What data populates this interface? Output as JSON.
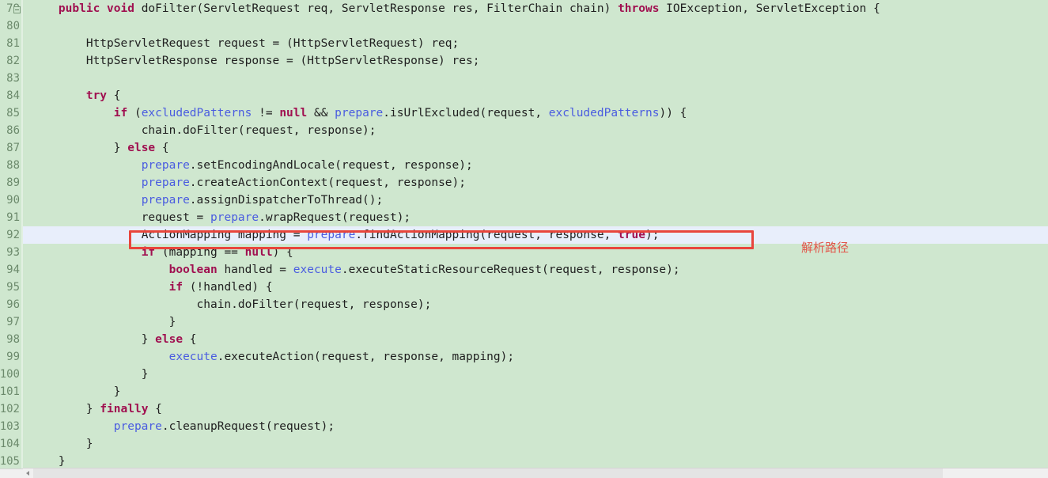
{
  "editor": {
    "background_color": "#cfe7cf",
    "current_line_color": "#e8eefb",
    "keyword_color": "#a01050",
    "field_color": "#4a5ce0",
    "text_color": "#202020",
    "gutter_number_color": "#6c8a6c",
    "highlight_box_color": "#e8453c",
    "annotation_color": "#e2574c",
    "first_line_number": 79,
    "current_line_number": 92
  },
  "gutter": {
    "line_numbers": [
      "79",
      "80",
      "81",
      "82",
      "83",
      "84",
      "85",
      "86",
      "87",
      "88",
      "89",
      "90",
      "91",
      "92",
      "93",
      "94",
      "95",
      "96",
      "97",
      "98",
      "99",
      "100",
      "101",
      "102",
      "103",
      "104",
      "105"
    ],
    "fold_marker_line": "79"
  },
  "annotation": {
    "text": "解析路径"
  },
  "code": {
    "lines": [
      {
        "n": "79",
        "indent": 4,
        "tokens": [
          {
            "t": "public",
            "c": "kw"
          },
          {
            "t": " ",
            "c": "plain"
          },
          {
            "t": "void",
            "c": "kw"
          },
          {
            "t": " doFilter(ServletRequest req, ServletResponse res, FilterChain chain) ",
            "c": "plain"
          },
          {
            "t": "throws",
            "c": "kw"
          },
          {
            "t": " IOException, ServletException {",
            "c": "plain"
          }
        ]
      },
      {
        "n": "80",
        "indent": 0,
        "tokens": [
          {
            "t": "",
            "c": "plain"
          }
        ]
      },
      {
        "n": "81",
        "indent": 8,
        "tokens": [
          {
            "t": "HttpServletRequest request = (HttpServletRequest) req;",
            "c": "plain"
          }
        ]
      },
      {
        "n": "82",
        "indent": 8,
        "tokens": [
          {
            "t": "HttpServletResponse response = (HttpServletResponse) res;",
            "c": "plain"
          }
        ]
      },
      {
        "n": "83",
        "indent": 0,
        "tokens": [
          {
            "t": "",
            "c": "plain"
          }
        ]
      },
      {
        "n": "84",
        "indent": 8,
        "tokens": [
          {
            "t": "try",
            "c": "kw"
          },
          {
            "t": " {",
            "c": "plain"
          }
        ]
      },
      {
        "n": "85",
        "indent": 12,
        "tokens": [
          {
            "t": "if",
            "c": "kw"
          },
          {
            "t": " (",
            "c": "plain"
          },
          {
            "t": "excludedPatterns",
            "c": "fld"
          },
          {
            "t": " != ",
            "c": "plain"
          },
          {
            "t": "null",
            "c": "kw"
          },
          {
            "t": " && ",
            "c": "plain"
          },
          {
            "t": "prepare",
            "c": "fld"
          },
          {
            "t": ".isUrlExcluded(request, ",
            "c": "plain"
          },
          {
            "t": "excludedPatterns",
            "c": "fld"
          },
          {
            "t": ")) {",
            "c": "plain"
          }
        ]
      },
      {
        "n": "86",
        "indent": 16,
        "tokens": [
          {
            "t": "chain.doFilter(request, response);",
            "c": "plain"
          }
        ]
      },
      {
        "n": "87",
        "indent": 12,
        "tokens": [
          {
            "t": "} ",
            "c": "plain"
          },
          {
            "t": "else",
            "c": "kw"
          },
          {
            "t": " {",
            "c": "plain"
          }
        ]
      },
      {
        "n": "88",
        "indent": 16,
        "tokens": [
          {
            "t": "prepare",
            "c": "fld"
          },
          {
            "t": ".setEncodingAndLocale(request, response);",
            "c": "plain"
          }
        ]
      },
      {
        "n": "89",
        "indent": 16,
        "tokens": [
          {
            "t": "prepare",
            "c": "fld"
          },
          {
            "t": ".createActionContext(request, response);",
            "c": "plain"
          }
        ]
      },
      {
        "n": "90",
        "indent": 16,
        "tokens": [
          {
            "t": "prepare",
            "c": "fld"
          },
          {
            "t": ".assignDispatcherToThread();",
            "c": "plain"
          }
        ]
      },
      {
        "n": "91",
        "indent": 16,
        "tokens": [
          {
            "t": "request = ",
            "c": "plain"
          },
          {
            "t": "prepare",
            "c": "fld"
          },
          {
            "t": ".wrapRequest(request);",
            "c": "plain"
          }
        ]
      },
      {
        "n": "92",
        "indent": 16,
        "tokens": [
          {
            "t": "ActionMapping mapping = ",
            "c": "plain"
          },
          {
            "t": "prepare",
            "c": "fld"
          },
          {
            "t": ".findActionMapping(request, response, ",
            "c": "plain"
          },
          {
            "t": "true",
            "c": "kw"
          },
          {
            "t": ");",
            "c": "plain"
          }
        ],
        "current": true
      },
      {
        "n": "93",
        "indent": 16,
        "tokens": [
          {
            "t": "if",
            "c": "kw"
          },
          {
            "t": " (mapping == ",
            "c": "plain"
          },
          {
            "t": "null",
            "c": "kw"
          },
          {
            "t": ") {",
            "c": "plain"
          }
        ]
      },
      {
        "n": "94",
        "indent": 20,
        "tokens": [
          {
            "t": "boolean",
            "c": "kw"
          },
          {
            "t": " handled = ",
            "c": "plain"
          },
          {
            "t": "execute",
            "c": "fld"
          },
          {
            "t": ".executeStaticResourceRequest(request, response);",
            "c": "plain"
          }
        ]
      },
      {
        "n": "95",
        "indent": 20,
        "tokens": [
          {
            "t": "if",
            "c": "kw"
          },
          {
            "t": " (!handled) {",
            "c": "plain"
          }
        ]
      },
      {
        "n": "96",
        "indent": 24,
        "tokens": [
          {
            "t": "chain.doFilter(request, response);",
            "c": "plain"
          }
        ]
      },
      {
        "n": "97",
        "indent": 20,
        "tokens": [
          {
            "t": "}",
            "c": "plain"
          }
        ]
      },
      {
        "n": "98",
        "indent": 16,
        "tokens": [
          {
            "t": "} ",
            "c": "plain"
          },
          {
            "t": "else",
            "c": "kw"
          },
          {
            "t": " {",
            "c": "plain"
          }
        ]
      },
      {
        "n": "99",
        "indent": 20,
        "tokens": [
          {
            "t": "execute",
            "c": "fld"
          },
          {
            "t": ".executeAction(request, response, mapping);",
            "c": "plain"
          }
        ]
      },
      {
        "n": "100",
        "indent": 16,
        "tokens": [
          {
            "t": "}",
            "c": "plain"
          }
        ]
      },
      {
        "n": "101",
        "indent": 12,
        "tokens": [
          {
            "t": "}",
            "c": "plain"
          }
        ]
      },
      {
        "n": "102",
        "indent": 8,
        "tokens": [
          {
            "t": "} ",
            "c": "plain"
          },
          {
            "t": "finally",
            "c": "kw"
          },
          {
            "t": " {",
            "c": "plain"
          }
        ]
      },
      {
        "n": "103",
        "indent": 12,
        "tokens": [
          {
            "t": "prepare",
            "c": "fld"
          },
          {
            "t": ".cleanupRequest(request);",
            "c": "plain"
          }
        ]
      },
      {
        "n": "104",
        "indent": 8,
        "tokens": [
          {
            "t": "}",
            "c": "plain"
          }
        ]
      },
      {
        "n": "105",
        "indent": 4,
        "tokens": [
          {
            "t": "}",
            "c": "plain"
          }
        ]
      }
    ]
  }
}
